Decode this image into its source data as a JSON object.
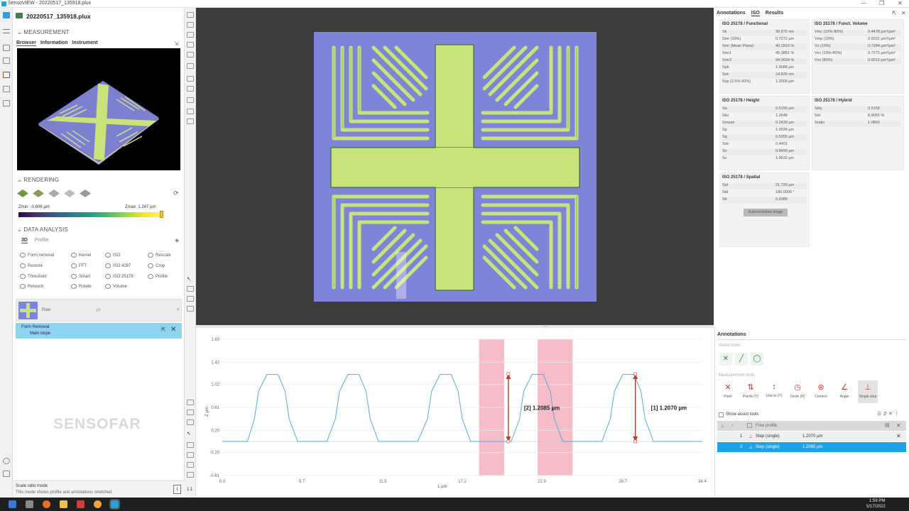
{
  "window": {
    "title": "SensoVIEW - 20220517_135918.plux",
    "min": "—",
    "max": "❐",
    "close": "✕"
  },
  "file": {
    "name": "20220517_135918.plux"
  },
  "measurement": {
    "heading": "MEASUREMENT",
    "tabs": [
      "Browser",
      "Information",
      "Instrument"
    ]
  },
  "rendering": {
    "heading": "RENDERING",
    "zmin": "Zmin: -0.606 µm",
    "zmax": "Zmax: 1.247 µm"
  },
  "analysis": {
    "heading": "DATA ANALYSIS",
    "tabs": [
      "3D",
      "Profile"
    ],
    "col1": [
      "Form removal",
      "Restore",
      "Threshold",
      "Retouch"
    ],
    "col2": [
      "Kernel",
      "FFT",
      "Smart",
      "Rotate"
    ],
    "col3": [
      "ISO",
      "ISO 4287",
      "ISO 25178",
      "Volume"
    ],
    "col4": [
      "Rescale",
      "Crop",
      "Profile"
    ]
  },
  "pipeline": {
    "raw": "Raw",
    "form_title": "Form Removal",
    "form_sub": "Main slope"
  },
  "brand": "SENSOFAR",
  "status": {
    "line1": "Scale ratio mode",
    "line2": "This mode shows profile and annotations stretched"
  },
  "vstrip_label": "1:1",
  "right_tabs": [
    "Annotations",
    "ISO",
    "Results"
  ],
  "iso": {
    "functional": {
      "title": "ISO 25178 / Functional",
      "rows": [
        [
          "Sk",
          "39.875 nm"
        ],
        [
          "Smr (10%)",
          "0.7272 µm"
        ],
        [
          "Smr (Mean Plane)",
          "40.1810 %"
        ],
        [
          "Smr1",
          "45.3881 %"
        ],
        [
          "Smr2",
          "94.0034 %"
        ],
        [
          "Spk",
          "1.9088 µm"
        ],
        [
          "Svk",
          "14.826 nm"
        ],
        [
          "Sxp (2.5%-50%)",
          "1.2009 µm"
        ]
      ]
    },
    "volume": {
      "title": "ISO 25178 / Funct. Volume",
      "rows": [
        [
          "Vmc (10%-80%)",
          "0.4478 µm³/µm²"
        ],
        [
          "Vmp (10%)",
          "0.0031 µm³/µm²"
        ],
        [
          "Vv (10%)",
          "0.7284 µm³/µm²"
        ],
        [
          "Vvc (10%-80%)",
          "0.7272 µm³/µm²"
        ],
        [
          "Vvv (80%)",
          "0.0012 µm³/µm²"
        ]
      ]
    },
    "height": {
      "title": "ISO 25178 / Height",
      "rows": [
        [
          "Sa",
          "0.5156 µm"
        ],
        [
          "Sku",
          "1.2648"
        ],
        [
          "Smean",
          "0.2439 µm"
        ],
        [
          "Sp",
          "1.0034 µm"
        ],
        [
          "Sq",
          "0.5355 µm"
        ],
        [
          "Ssk",
          "0.4401"
        ],
        [
          "Sv",
          "0.8499 µm"
        ],
        [
          "Sz",
          "1.8532 µm"
        ]
      ]
    },
    "hybrid": {
      "title": "ISO 25178 / Hybrid",
      "rows": [
        [
          "Sdq",
          "0.5158"
        ],
        [
          "Sdr",
          "8.9055 %"
        ],
        [
          "Sratio",
          "1.0891"
        ]
      ]
    },
    "spatial": {
      "title": "ISO 25178 / Spatial",
      "rows": [
        [
          "Sal",
          "21.726 µm"
        ],
        [
          "Std",
          "180.0000 °"
        ],
        [
          "Str",
          "0.2089"
        ]
      ],
      "button": "Autocorrelation image"
    }
  },
  "annotations": {
    "title": "Annotations",
    "assist_label": "Assist tools",
    "measure_label": "Measurement tools",
    "tools": [
      "Point",
      "Points (Y)",
      "Line to (Y)",
      "Circle (R)",
      "Centers",
      "Angle",
      "Single step"
    ],
    "show_assist": "Show assist tools",
    "list_header": "Free profile",
    "list": [
      [
        "1",
        "Step (single)",
        "1.2070 µm"
      ],
      [
        "2",
        "Step (single)",
        "1.2085 µm"
      ]
    ]
  },
  "chart_data": {
    "type": "line",
    "title": "",
    "xlabel": "L µm",
    "ylabel": "Z µm",
    "xlim": [
      0.0,
      34.4
    ],
    "ylim": [
      -0.61,
      1.83
    ],
    "x_ticks": [
      "0.0",
      "5.7",
      "11.5",
      "17.2",
      "22.9",
      "28.7",
      "34.4"
    ],
    "y_ticks": [
      "1.83",
      "1.42",
      "1.02",
      "0.61",
      "0.20",
      "-0.20",
      "-0.61"
    ],
    "series": [
      {
        "x": [
          0.0,
          1.8,
          2.3,
          2.6,
          3.2,
          4.0,
          4.5,
          4.8,
          5.4,
          7.5,
          8.1,
          8.4,
          9.0,
          9.8,
          10.3,
          10.6,
          11.2,
          14.0,
          14.7,
          15.0,
          15.6,
          16.4,
          16.9,
          17.2,
          17.8,
          20.7,
          21.3,
          21.6,
          22.2,
          23.0,
          23.5,
          23.8,
          24.4,
          27.2,
          27.8,
          28.1,
          28.7,
          29.5,
          30.0,
          30.3,
          30.9,
          34.4
        ],
        "values": [
          0.0,
          0.0,
          0.4,
          0.9,
          1.2,
          1.2,
          0.9,
          0.4,
          0.0,
          0.0,
          0.4,
          0.9,
          1.2,
          1.2,
          0.9,
          0.4,
          0.0,
          0.0,
          0.4,
          0.9,
          1.2,
          1.2,
          0.9,
          0.4,
          0.0,
          0.0,
          0.4,
          0.9,
          1.2,
          1.2,
          0.9,
          0.4,
          0.0,
          0.0,
          0.4,
          0.9,
          1.2,
          1.2,
          0.9,
          0.4,
          0.0,
          0.0
        ]
      }
    ],
    "bands": [
      [
        18.4,
        20.2
      ],
      [
        22.6,
        25.1
      ]
    ],
    "annotations": [
      {
        "x": 20.5,
        "y0": 0.0,
        "y1": 1.2085,
        "label": "[2] 1.2085 µm",
        "color": "#c0392b"
      },
      {
        "x": 29.6,
        "y0": 0.0,
        "y1": 1.207,
        "label": "[1] 1.2070 µm",
        "color": "#c0392b"
      }
    ]
  },
  "taskbar": {
    "time": "1:59 PM",
    "date": "5/17/2022"
  },
  "colors": {
    "accent": "#29a3da",
    "selected": "#1aa3e8",
    "band": "#f3a7b5",
    "curve": "#5aa8d6",
    "marker": "#c0392b"
  }
}
